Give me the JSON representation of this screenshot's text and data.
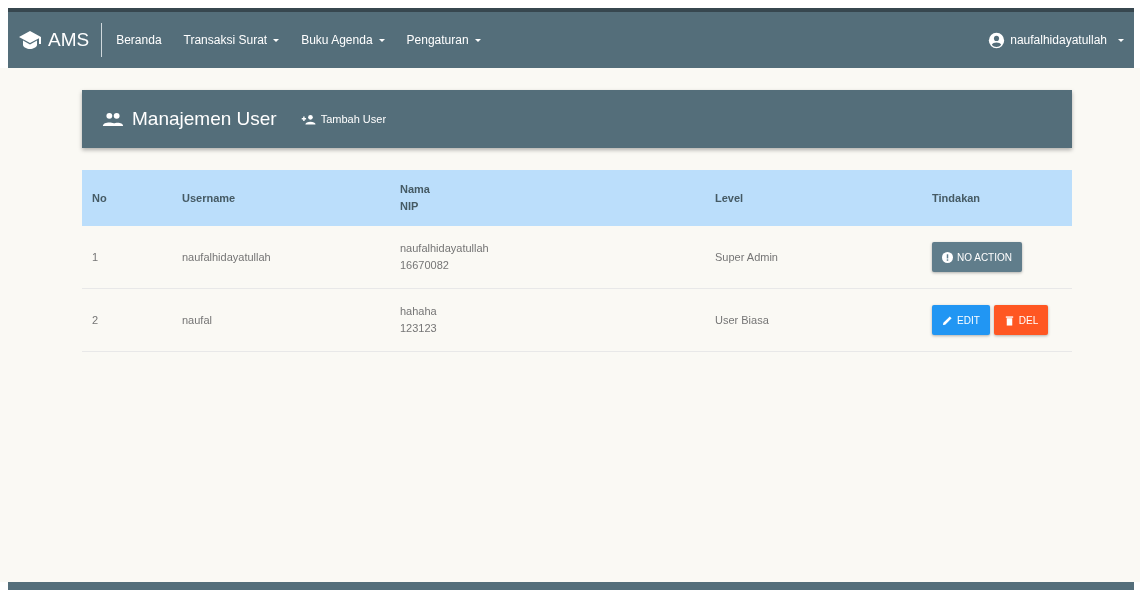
{
  "navbar": {
    "brand": "AMS",
    "items": [
      {
        "label": "Beranda",
        "dropdown": false
      },
      {
        "label": "Transaksi Surat",
        "dropdown": true
      },
      {
        "label": "Buku Agenda",
        "dropdown": true
      },
      {
        "label": "Pengaturan",
        "dropdown": true
      }
    ],
    "user": {
      "label": "naufalhidayatullah",
      "dropdown": true
    }
  },
  "header": {
    "title": "Manajemen User",
    "add_button": "Tambah User"
  },
  "table": {
    "columns": [
      {
        "lines": [
          "No"
        ]
      },
      {
        "lines": [
          "Username"
        ]
      },
      {
        "lines": [
          "Nama",
          "NIP"
        ]
      },
      {
        "lines": [
          "Level"
        ]
      },
      {
        "lines": [
          "Tindakan"
        ]
      }
    ],
    "rows": [
      {
        "no": "1",
        "username": "naufalhidayatullah",
        "nama": "naufalhidayatullah",
        "nip": "16670082",
        "level": "Super Admin",
        "actions": [
          {
            "kind": "none",
            "label": "NO ACTION"
          }
        ]
      },
      {
        "no": "2",
        "username": "naufal",
        "nama": "hahaha",
        "nip": "123123",
        "level": "User Biasa",
        "actions": [
          {
            "kind": "edit",
            "label": "EDIT"
          },
          {
            "kind": "delete",
            "label": "DEL"
          }
        ]
      }
    ]
  }
}
